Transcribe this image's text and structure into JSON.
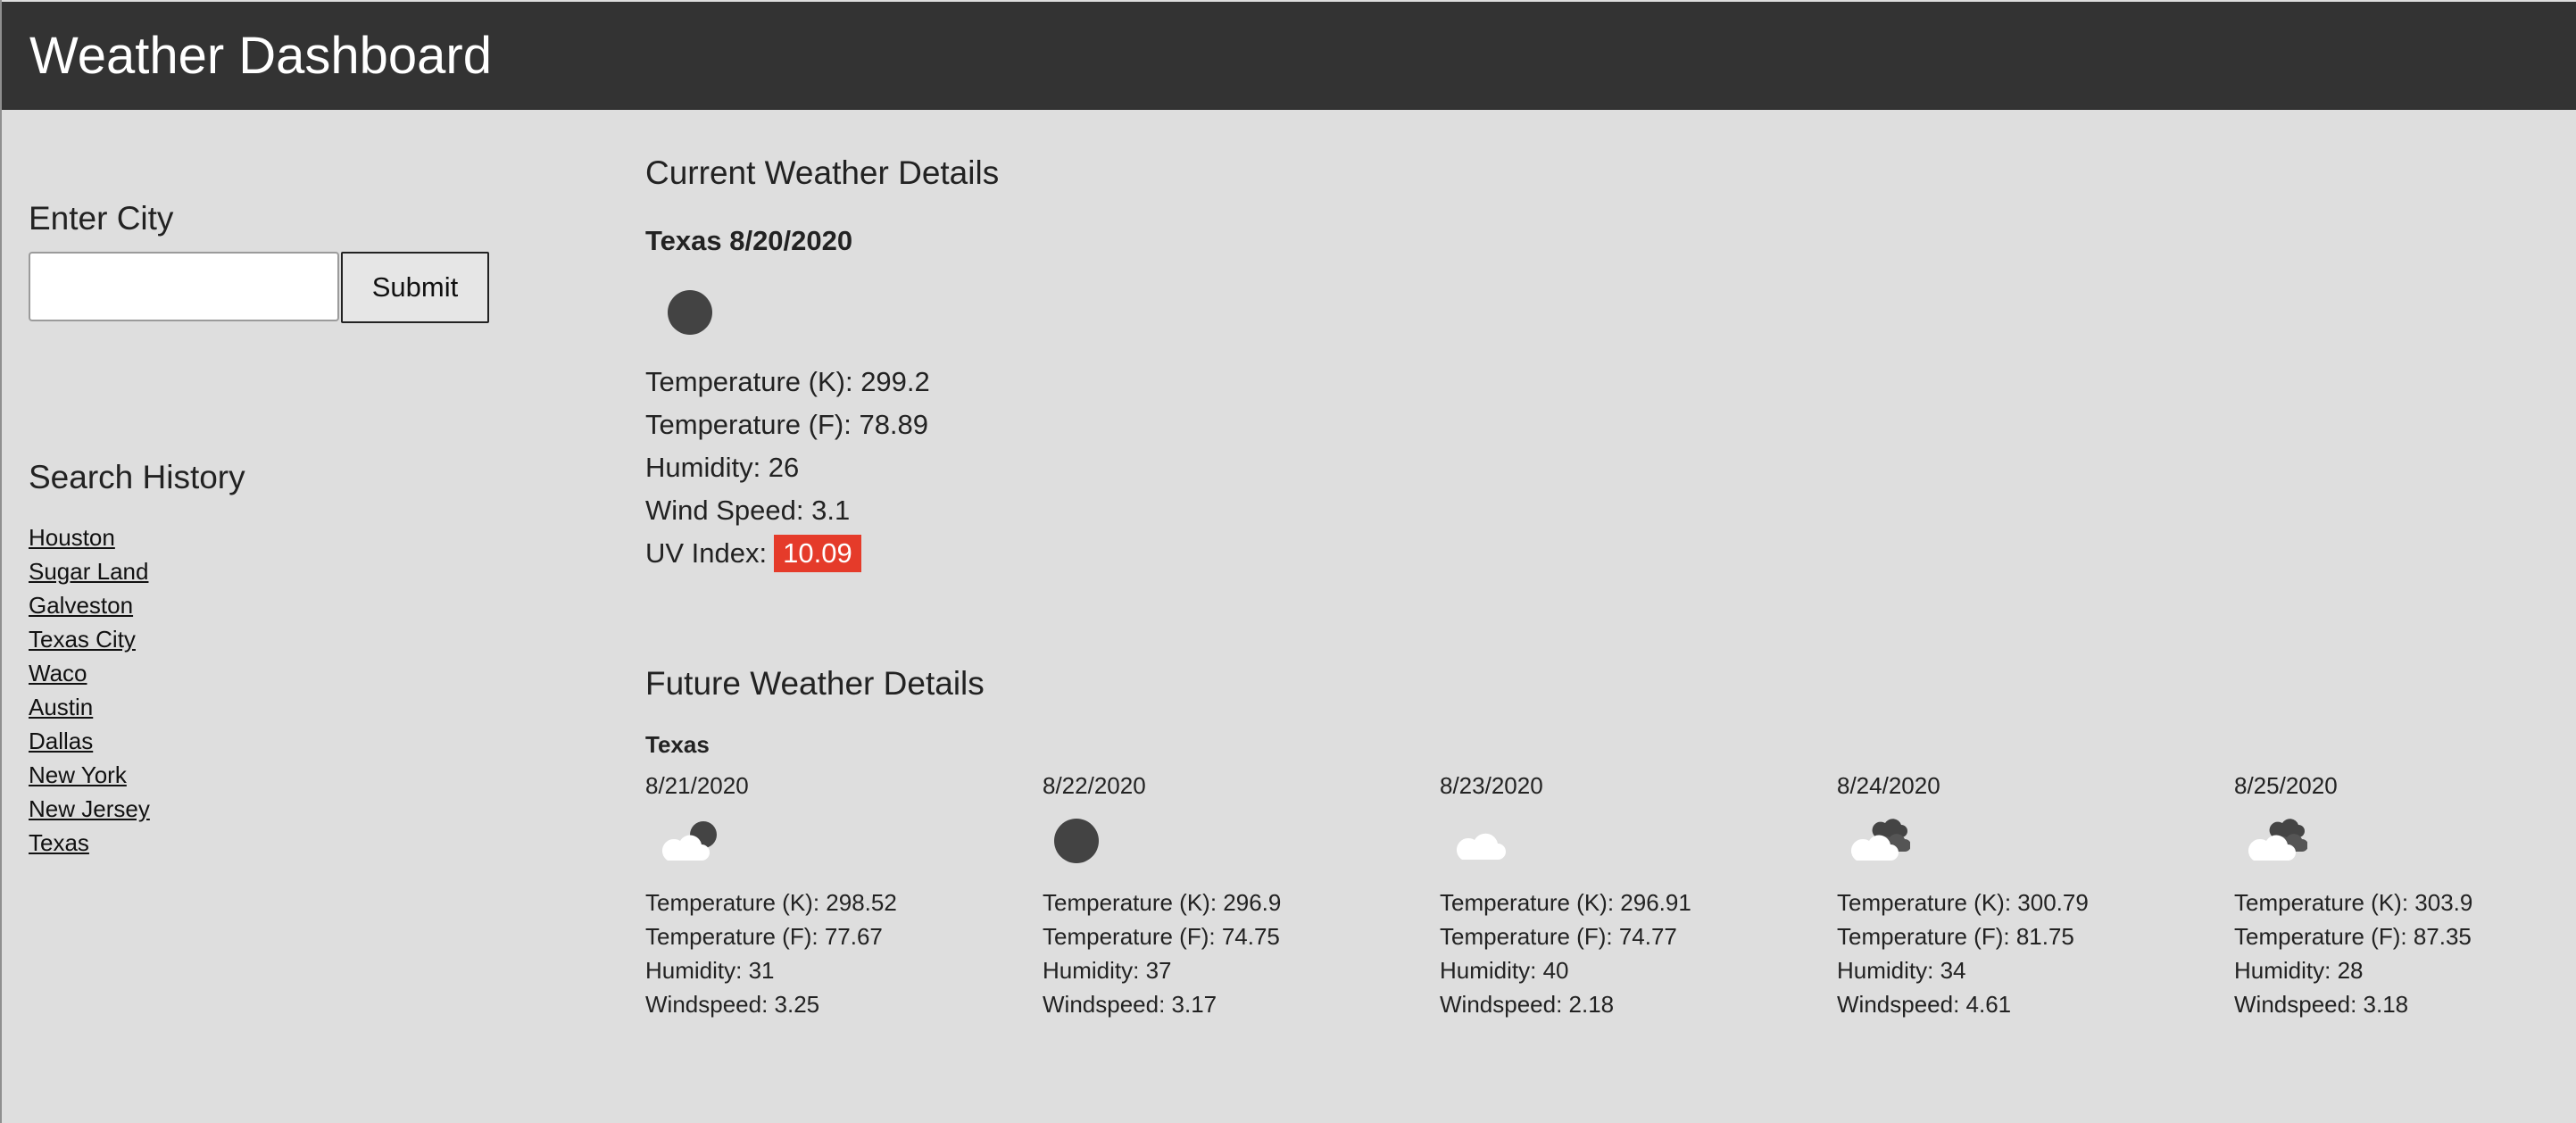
{
  "header": {
    "title": "Weather Dashboard"
  },
  "search": {
    "heading": "Enter City",
    "input_value": "",
    "submit_label": "Submit"
  },
  "history": {
    "heading": "Search History",
    "items": [
      "Houston",
      "Sugar Land",
      "Galveston",
      "Texas City",
      "Waco",
      "Austin",
      "Dallas",
      "New York",
      "New Jersey",
      "Texas"
    ]
  },
  "current": {
    "heading": "Current Weather Details",
    "city_date": "Texas 8/20/2020",
    "icon": "clear-night-icon",
    "temp_k_label": "Temperature (K): 299.2",
    "temp_f_label": "Temperature (F): 78.89",
    "humidity_label": "Humidity: 26",
    "wind_label": "Wind Speed: 3.1",
    "uv_label": "UV Index:",
    "uv_value": "10.09",
    "uv_color": "#e53b2a"
  },
  "future": {
    "heading": "Future Weather Details",
    "city": "Texas",
    "days": [
      {
        "date": "8/21/2020",
        "icon": "few-clouds-night-icon",
        "temp_k": "Temperature (K): 298.52",
        "temp_f": "Temperature (F): 77.67",
        "humidity": "Humidity: 31",
        "windspeed": "Windspeed: 3.25"
      },
      {
        "date": "8/22/2020",
        "icon": "clear-night-icon",
        "temp_k": "Temperature (K): 296.9",
        "temp_f": "Temperature (F): 74.75",
        "humidity": "Humidity: 37",
        "windspeed": "Windspeed: 3.17"
      },
      {
        "date": "8/23/2020",
        "icon": "cloud-icon",
        "temp_k": "Temperature (K): 296.91",
        "temp_f": "Temperature (F): 74.77",
        "humidity": "Humidity: 40",
        "windspeed": "Windspeed: 2.18"
      },
      {
        "date": "8/24/2020",
        "icon": "broken-clouds-icon",
        "temp_k": "Temperature (K): 300.79",
        "temp_f": "Temperature (F): 81.75",
        "humidity": "Humidity: 34",
        "windspeed": "Windspeed: 4.61"
      },
      {
        "date": "8/25/2020",
        "icon": "broken-clouds-icon",
        "temp_k": "Temperature (K): 303.9",
        "temp_f": "Temperature (F): 87.35",
        "humidity": "Humidity: 28",
        "windspeed": "Windspeed: 3.18"
      }
    ]
  },
  "colors": {
    "header_bg": "#333333",
    "page_bg": "#dedede",
    "uv_high": "#e53b2a"
  }
}
